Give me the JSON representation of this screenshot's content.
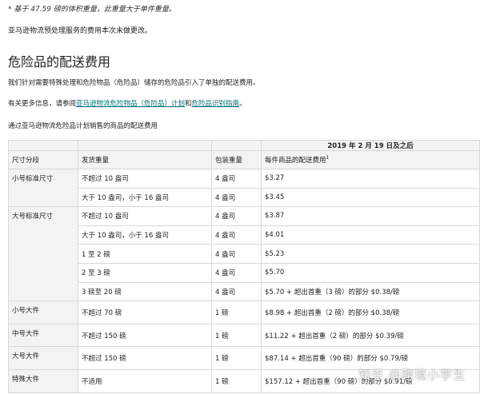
{
  "note": "* 基于 47.59 磅的体积重量，此重量大于单件重量。",
  "change_notice": "亚马逊物流预处理服务的费用本次未做更改。",
  "section_title": "危险品的配送费用",
  "intro": "我们针对需要特殊处理和危险物品（危险品）储存的危险品引入了单独的配送费用。",
  "more_info": {
    "prefix": "有关更多信息，请参阅",
    "link1": "亚马逊物流危险物品（危险品）计划",
    "middle": "和",
    "link2": "危险品识别指南",
    "suffix": "。"
  },
  "table_title": "通过亚马逊物流危险品计划销售的商品的配送费用",
  "table": {
    "date_header": "2019 年 2 月 19 日及之后",
    "headers": [
      "尺寸分段",
      "发货重量",
      "包装重量",
      "每件商品的配送费用"
    ],
    "footnote_marker": "1",
    "groups": [
      {
        "tier": "小号标准尺寸",
        "rows": [
          {
            "weight": "不超过 10 盎司",
            "pack": "4 盎司",
            "fee": "$3.27"
          },
          {
            "weight": "大于 10 盎司，小于 16 盎司",
            "pack": "4 盎司",
            "fee": "$3.45"
          }
        ]
      },
      {
        "tier": "大号标准尺寸",
        "rows": [
          {
            "weight": "不超过 10 盎司",
            "pack": "4 盎司",
            "fee": "$3.87"
          },
          {
            "weight": "大于 10 盎司，小于 16 盎司",
            "pack": "4 盎司",
            "fee": "$4.01"
          },
          {
            "weight": "1 至 2 磅",
            "pack": "4 盎司",
            "fee": "$5.23"
          },
          {
            "weight": "2 至 3 磅",
            "pack": "4 盎司",
            "fee": "$5.70"
          },
          {
            "weight": "3 磅至 20 磅",
            "pack": "4 盎司",
            "fee": "$5.70 + 超出首重（3 磅）的部分 $0.38/磅"
          }
        ]
      },
      {
        "tier": "小号大件",
        "rows": [
          {
            "weight": "不超过 70 磅",
            "pack": "1 磅",
            "fee": "$8.98 + 超出首重（2 磅）的部分 $0.38/磅"
          }
        ]
      },
      {
        "tier": "中号大件",
        "rows": [
          {
            "weight": "不超过 150 磅",
            "pack": "1 磅",
            "fee": "$11.22 + 超出首重（2 磅）的部分 $0.39/磅"
          }
        ]
      },
      {
        "tier": "大号大件",
        "rows": [
          {
            "weight": "不超过 150 磅",
            "pack": "1 磅",
            "fee": "$87.14 + 超出首重（90 磅）的部分 $0.79/磅"
          }
        ]
      },
      {
        "tier": "特殊大件",
        "rows": [
          {
            "weight": "不适用",
            "pack": "1 磅",
            "fee": "$157.12 + 超出首重（90 磅）的部分 $0.91/磅"
          }
        ]
      }
    ]
  },
  "watermark": "知乎 @跨境小学生"
}
